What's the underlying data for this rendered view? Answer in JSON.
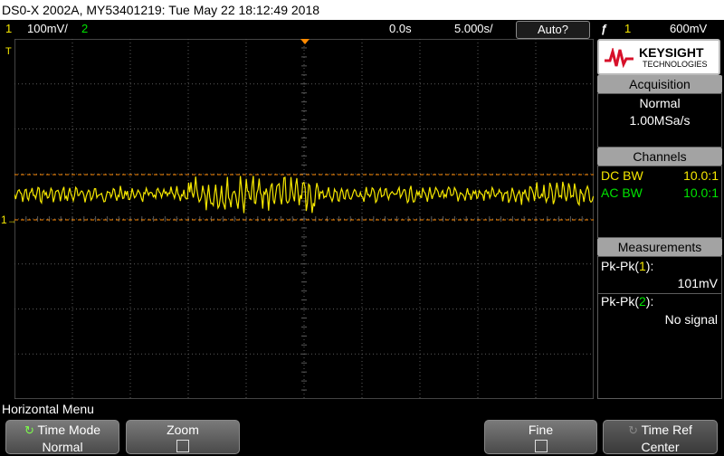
{
  "title_bar": {
    "text": "DS0-X 2002A, MY53401219: Tue May 22 18:12:49 2018"
  },
  "status": {
    "ch1_num": "1",
    "ch1_scale": "100mV/",
    "ch2_num": "2",
    "time_offset": "0.0s",
    "time_scale": "5.000s/",
    "auto_label": "Auto?",
    "trigger_icon": "trigger-edge-icon",
    "trigger_source": "1",
    "trigger_level": "600mV"
  },
  "screen": {
    "trigger_marker_label": "T",
    "ch1_marker_label": "1"
  },
  "panel": {
    "logo_name": "KEYSIGHT",
    "logo_sub": "TECHNOLOGIES",
    "acquisition_head": "Acquisition",
    "acq_mode": "Normal",
    "acq_rate": "1.00MSa/s",
    "channels_head": "Channels",
    "ch1_coupling": "DC BW",
    "ch1_probe": "10.0:1",
    "ch2_coupling": "AC BW",
    "ch2_probe": "10.0:1",
    "measurements_head": "Measurements",
    "meas1_label": "Pk-Pk(",
    "meas1_ch": "1",
    "meas1_close": "):",
    "meas1_value": "101mV",
    "meas2_label": "Pk-Pk(",
    "meas2_ch": "2",
    "meas2_close": "):",
    "meas2_value": "No signal"
  },
  "menu": {
    "label": "Horizontal Menu",
    "keys": [
      {
        "line1": "Time Mode",
        "line2": "Normal"
      },
      {
        "line1": "Zoom",
        "line2": ""
      },
      {
        "line1": "Fine",
        "line2": ""
      },
      {
        "line1": "Time Ref",
        "line2": "Center"
      }
    ]
  },
  "colors": {
    "ch1": "#f5e700",
    "ch2": "#00e400",
    "cursor": "#ff8a00",
    "grid": "#5a5a5a"
  }
}
